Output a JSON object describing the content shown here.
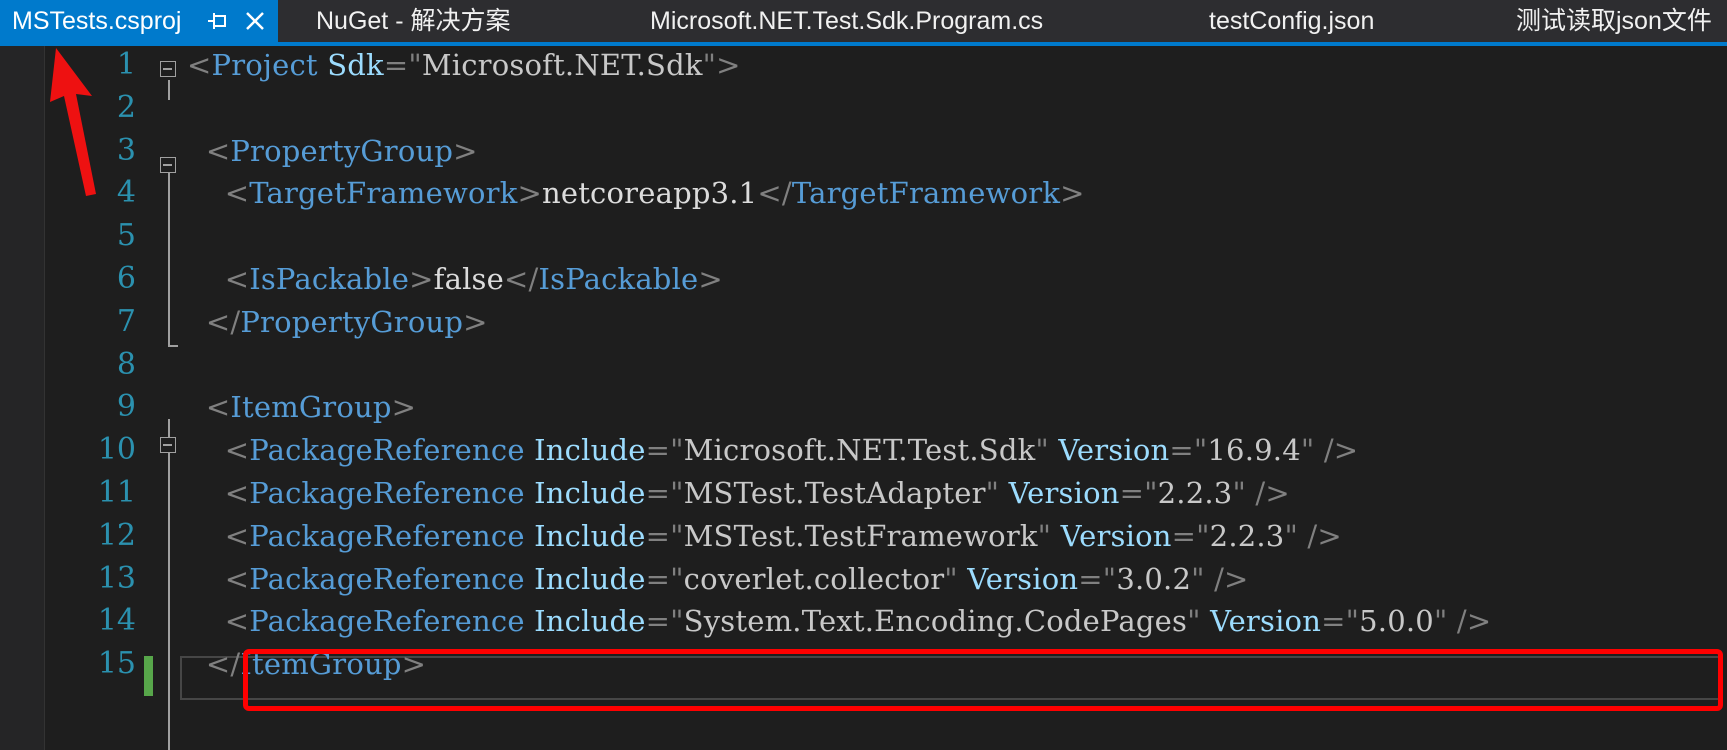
{
  "tabs": [
    {
      "label": "MSTests.csproj",
      "active": true
    },
    {
      "label": "NuGet - 解决方案",
      "active": false
    },
    {
      "label": "Microsoft.NET.Test.Sdk.Program.cs",
      "active": false
    },
    {
      "label": "testConfig.json",
      "active": false
    },
    {
      "label": "测试读取json文件",
      "active": false
    }
  ],
  "icons": {
    "pin": "pin-icon",
    "close": "close-icon",
    "fold": "collapse-icon"
  },
  "colors": {
    "accent": "#007acc",
    "editor_background": "#1e1e1e",
    "line_number": "#2b91af",
    "xml_tag": "#569cd6",
    "xml_attribute": "#9cdcfe",
    "xml_delimiter": "#808080",
    "change_marker": "#57a64a",
    "annotation": "#ff0000"
  },
  "editor": {
    "lines": [
      {
        "n": "1",
        "segs": [
          [
            "d",
            "<"
          ],
          [
            "t",
            "Project"
          ],
          [
            "x",
            " "
          ],
          [
            "a",
            "Sdk"
          ],
          [
            "d",
            "=\""
          ],
          [
            "v",
            "Microsoft.NET.Sdk"
          ],
          [
            "d",
            "\">"
          ]
        ]
      },
      {
        "n": "2",
        "segs": []
      },
      {
        "n": "3",
        "segs": [
          [
            "x",
            "  "
          ],
          [
            "d",
            "<"
          ],
          [
            "t",
            "PropertyGroup"
          ],
          [
            "d",
            ">"
          ]
        ]
      },
      {
        "n": "4",
        "segs": [
          [
            "x",
            "    "
          ],
          [
            "d",
            "<"
          ],
          [
            "t",
            "TargetFramework"
          ],
          [
            "d",
            ">"
          ],
          [
            "x",
            "netcoreapp3.1"
          ],
          [
            "d",
            "</"
          ],
          [
            "t",
            "TargetFramework"
          ],
          [
            "d",
            ">"
          ]
        ]
      },
      {
        "n": "5",
        "segs": []
      },
      {
        "n": "6",
        "segs": [
          [
            "x",
            "    "
          ],
          [
            "d",
            "<"
          ],
          [
            "t",
            "IsPackable"
          ],
          [
            "d",
            ">"
          ],
          [
            "x",
            "false"
          ],
          [
            "d",
            "</"
          ],
          [
            "t",
            "IsPackable"
          ],
          [
            "d",
            ">"
          ]
        ]
      },
      {
        "n": "7",
        "segs": [
          [
            "x",
            "  "
          ],
          [
            "d",
            "</"
          ],
          [
            "t",
            "PropertyGroup"
          ],
          [
            "d",
            ">"
          ]
        ]
      },
      {
        "n": "8",
        "segs": []
      },
      {
        "n": "9",
        "segs": [
          [
            "x",
            "  "
          ],
          [
            "d",
            "<"
          ],
          [
            "t",
            "ItemGroup"
          ],
          [
            "d",
            ">"
          ]
        ]
      },
      {
        "n": "10",
        "segs": [
          [
            "x",
            "    "
          ],
          [
            "d",
            "<"
          ],
          [
            "t",
            "PackageReference"
          ],
          [
            "x",
            " "
          ],
          [
            "a",
            "Include"
          ],
          [
            "d",
            "=\""
          ],
          [
            "v",
            "Microsoft.NET.Test.Sdk"
          ],
          [
            "d",
            "\""
          ],
          [
            "x",
            " "
          ],
          [
            "a",
            "Version"
          ],
          [
            "d",
            "=\""
          ],
          [
            "v",
            "16.9.4"
          ],
          [
            "d",
            "\" />"
          ]
        ]
      },
      {
        "n": "11",
        "segs": [
          [
            "x",
            "    "
          ],
          [
            "d",
            "<"
          ],
          [
            "t",
            "PackageReference"
          ],
          [
            "x",
            " "
          ],
          [
            "a",
            "Include"
          ],
          [
            "d",
            "=\""
          ],
          [
            "v",
            "MSTest.TestAdapter"
          ],
          [
            "d",
            "\""
          ],
          [
            "x",
            " "
          ],
          [
            "a",
            "Version"
          ],
          [
            "d",
            "=\""
          ],
          [
            "v",
            "2.2.3"
          ],
          [
            "d",
            "\" />"
          ]
        ]
      },
      {
        "n": "12",
        "segs": [
          [
            "x",
            "    "
          ],
          [
            "d",
            "<"
          ],
          [
            "t",
            "PackageReference"
          ],
          [
            "x",
            " "
          ],
          [
            "a",
            "Include"
          ],
          [
            "d",
            "=\""
          ],
          [
            "v",
            "MSTest.TestFramework"
          ],
          [
            "d",
            "\""
          ],
          [
            "x",
            " "
          ],
          [
            "a",
            "Version"
          ],
          [
            "d",
            "=\""
          ],
          [
            "v",
            "2.2.3"
          ],
          [
            "d",
            "\" />"
          ]
        ]
      },
      {
        "n": "13",
        "segs": [
          [
            "x",
            "    "
          ],
          [
            "d",
            "<"
          ],
          [
            "t",
            "PackageReference"
          ],
          [
            "x",
            " "
          ],
          [
            "a",
            "Include"
          ],
          [
            "d",
            "=\""
          ],
          [
            "v",
            "coverlet.collector"
          ],
          [
            "d",
            "\""
          ],
          [
            "x",
            " "
          ],
          [
            "a",
            "Version"
          ],
          [
            "d",
            "=\""
          ],
          [
            "v",
            "3.0.2"
          ],
          [
            "d",
            "\" />"
          ]
        ]
      },
      {
        "n": "14",
        "segs": [
          [
            "x",
            "    "
          ],
          [
            "d",
            "<"
          ],
          [
            "t",
            "PackageReference"
          ],
          [
            "x",
            " "
          ],
          [
            "a",
            "Include"
          ],
          [
            "d",
            "=\""
          ],
          [
            "v",
            "System.Text.Encoding.CodePages"
          ],
          [
            "d",
            "\""
          ],
          [
            "x",
            " "
          ],
          [
            "a",
            "Version"
          ],
          [
            "d",
            "=\""
          ],
          [
            "v",
            "5.0.0"
          ],
          [
            "d",
            "\" />"
          ]
        ]
      },
      {
        "n": "15",
        "segs": [
          [
            "x",
            "  "
          ],
          [
            "d",
            "</"
          ],
          [
            "t",
            "ItemGroup"
          ],
          [
            "d",
            ">"
          ]
        ]
      }
    ]
  }
}
